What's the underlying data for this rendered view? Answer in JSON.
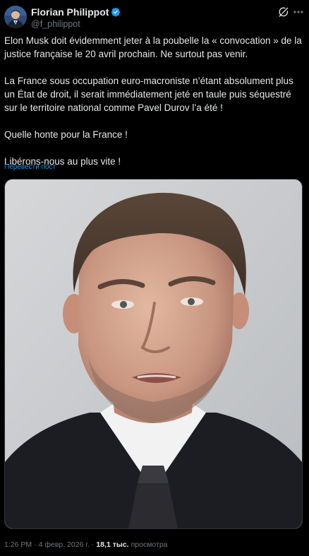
{
  "author": {
    "display_name": "Florian Philippot",
    "handle": "@f_philippot",
    "verified": true,
    "verified_color": "#1d9bf0",
    "avatar_icon": "avatar-portrait"
  },
  "actions": {
    "grok_icon": "grok-icon",
    "more_icon": "more-icon"
  },
  "post": {
    "paragraphs": [
      "Elon Musk doit évidemment jeter à la poubelle la « convocation » de la justice française le 20 avril prochain. Ne surtout pas venir.",
      "La France sous occupation euro-macroniste n’étant absolument plus un État de droit, il serait immédiatement jeté en taule puis séquestré sur le territoire national comme Pavel Durov l’a été !",
      "Quelle honte pour la France !",
      "Libérons-nous au plus vite !"
    ],
    "translate_label": "Перевести пост"
  },
  "meta": {
    "time": "1:26 PM",
    "separator": "·",
    "date": "4 февр. 2026 г.",
    "views_count": "18,1 тыс.",
    "views_label": "просмотра"
  },
  "colors": {
    "background": "#000000",
    "text": "#e7e9ea",
    "secondary": "#71767b",
    "link": "#1d9bf0"
  }
}
